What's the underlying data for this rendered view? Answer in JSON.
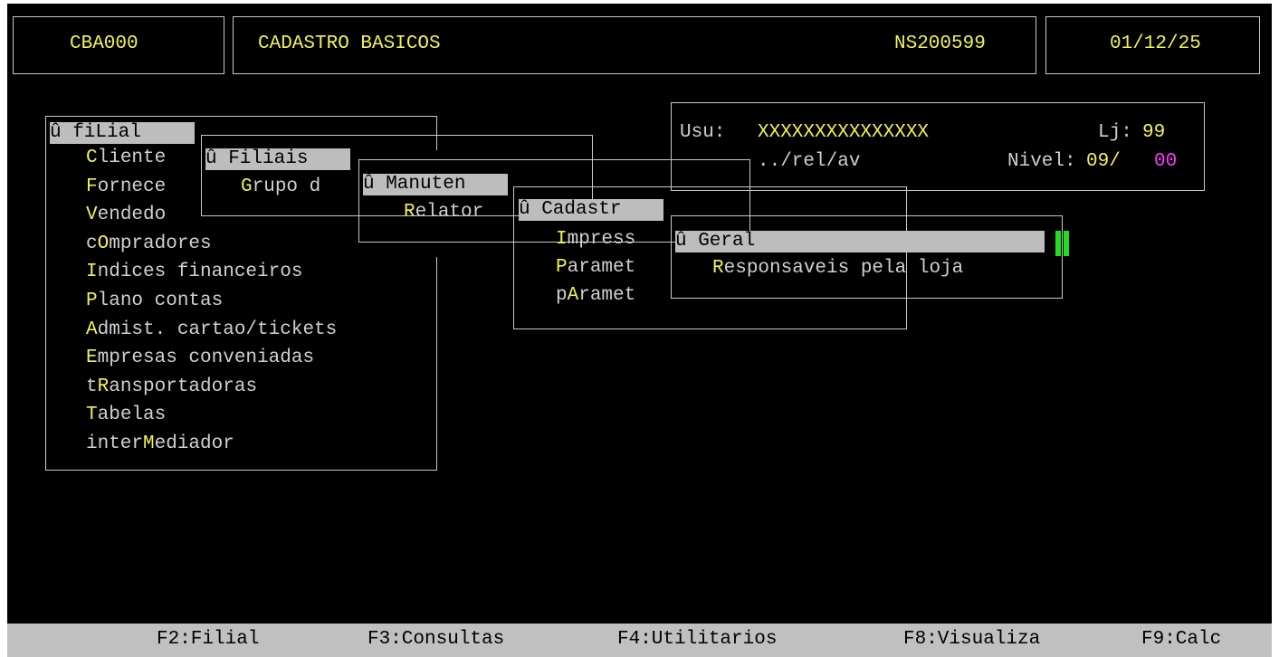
{
  "header": {
    "program_code": "CBA000",
    "title": "CADASTRO BASICOS",
    "serial": "NS200599",
    "date": "01/12/25"
  },
  "info": {
    "user_label": "Usu:",
    "user_value": "XXXXXXXXXXXXXXX",
    "store_label": "Lj:",
    "store_value": "99",
    "path": "../rel/av",
    "level_label": "Nivel:",
    "level_value": "09/",
    "level_sub": "00"
  },
  "menu1": {
    "title": "û fiLial",
    "items": [
      {
        "pre": "",
        "hot": "C",
        "post": "liente"
      },
      {
        "pre": "",
        "hot": "F",
        "post": "ornece"
      },
      {
        "pre": "",
        "hot": "V",
        "post": "endedo"
      },
      {
        "pre": "c",
        "hot": "O",
        "post": "mpradores"
      },
      {
        "pre": "",
        "hot": "I",
        "post": "ndices financeiros"
      },
      {
        "pre": "",
        "hot": "P",
        "post": "lano contas"
      },
      {
        "pre": "",
        "hot": "A",
        "post": "dmist. cartao/tickets"
      },
      {
        "pre": "",
        "hot": "E",
        "post": "mpresas conveniadas"
      },
      {
        "pre": "t",
        "hot": "R",
        "post": "ansportadoras"
      },
      {
        "pre": "",
        "hot": "T",
        "post": "abelas"
      },
      {
        "pre": "inter",
        "hot": "M",
        "post": "ediador"
      }
    ]
  },
  "menu2": {
    "title": "û Filiais",
    "items": [
      {
        "pre": "",
        "hot": "G",
        "post": "rupo d"
      }
    ]
  },
  "menu3": {
    "title": "û Manuten",
    "items": [
      {
        "pre": "",
        "hot": "R",
        "post": "elator"
      }
    ]
  },
  "menu4": {
    "title": "û Cadastr",
    "items": [
      {
        "pre": "",
        "hot": "I",
        "post": "mpress"
      },
      {
        "pre": "",
        "hot": "P",
        "post": "aramet"
      },
      {
        "pre": "p",
        "hot": "A",
        "post": "ramet"
      }
    ]
  },
  "menu5": {
    "title": "û Geral",
    "items": [
      {
        "pre": "",
        "hot": "R",
        "post": "esponsaveis pela loja"
      }
    ]
  },
  "statusbar": {
    "f2": "F2:Filial",
    "f3": "F3:Consultas",
    "f4": "F4:Utilitarios",
    "f8": "F8:Visualiza",
    "f9": "F9:Calc"
  }
}
